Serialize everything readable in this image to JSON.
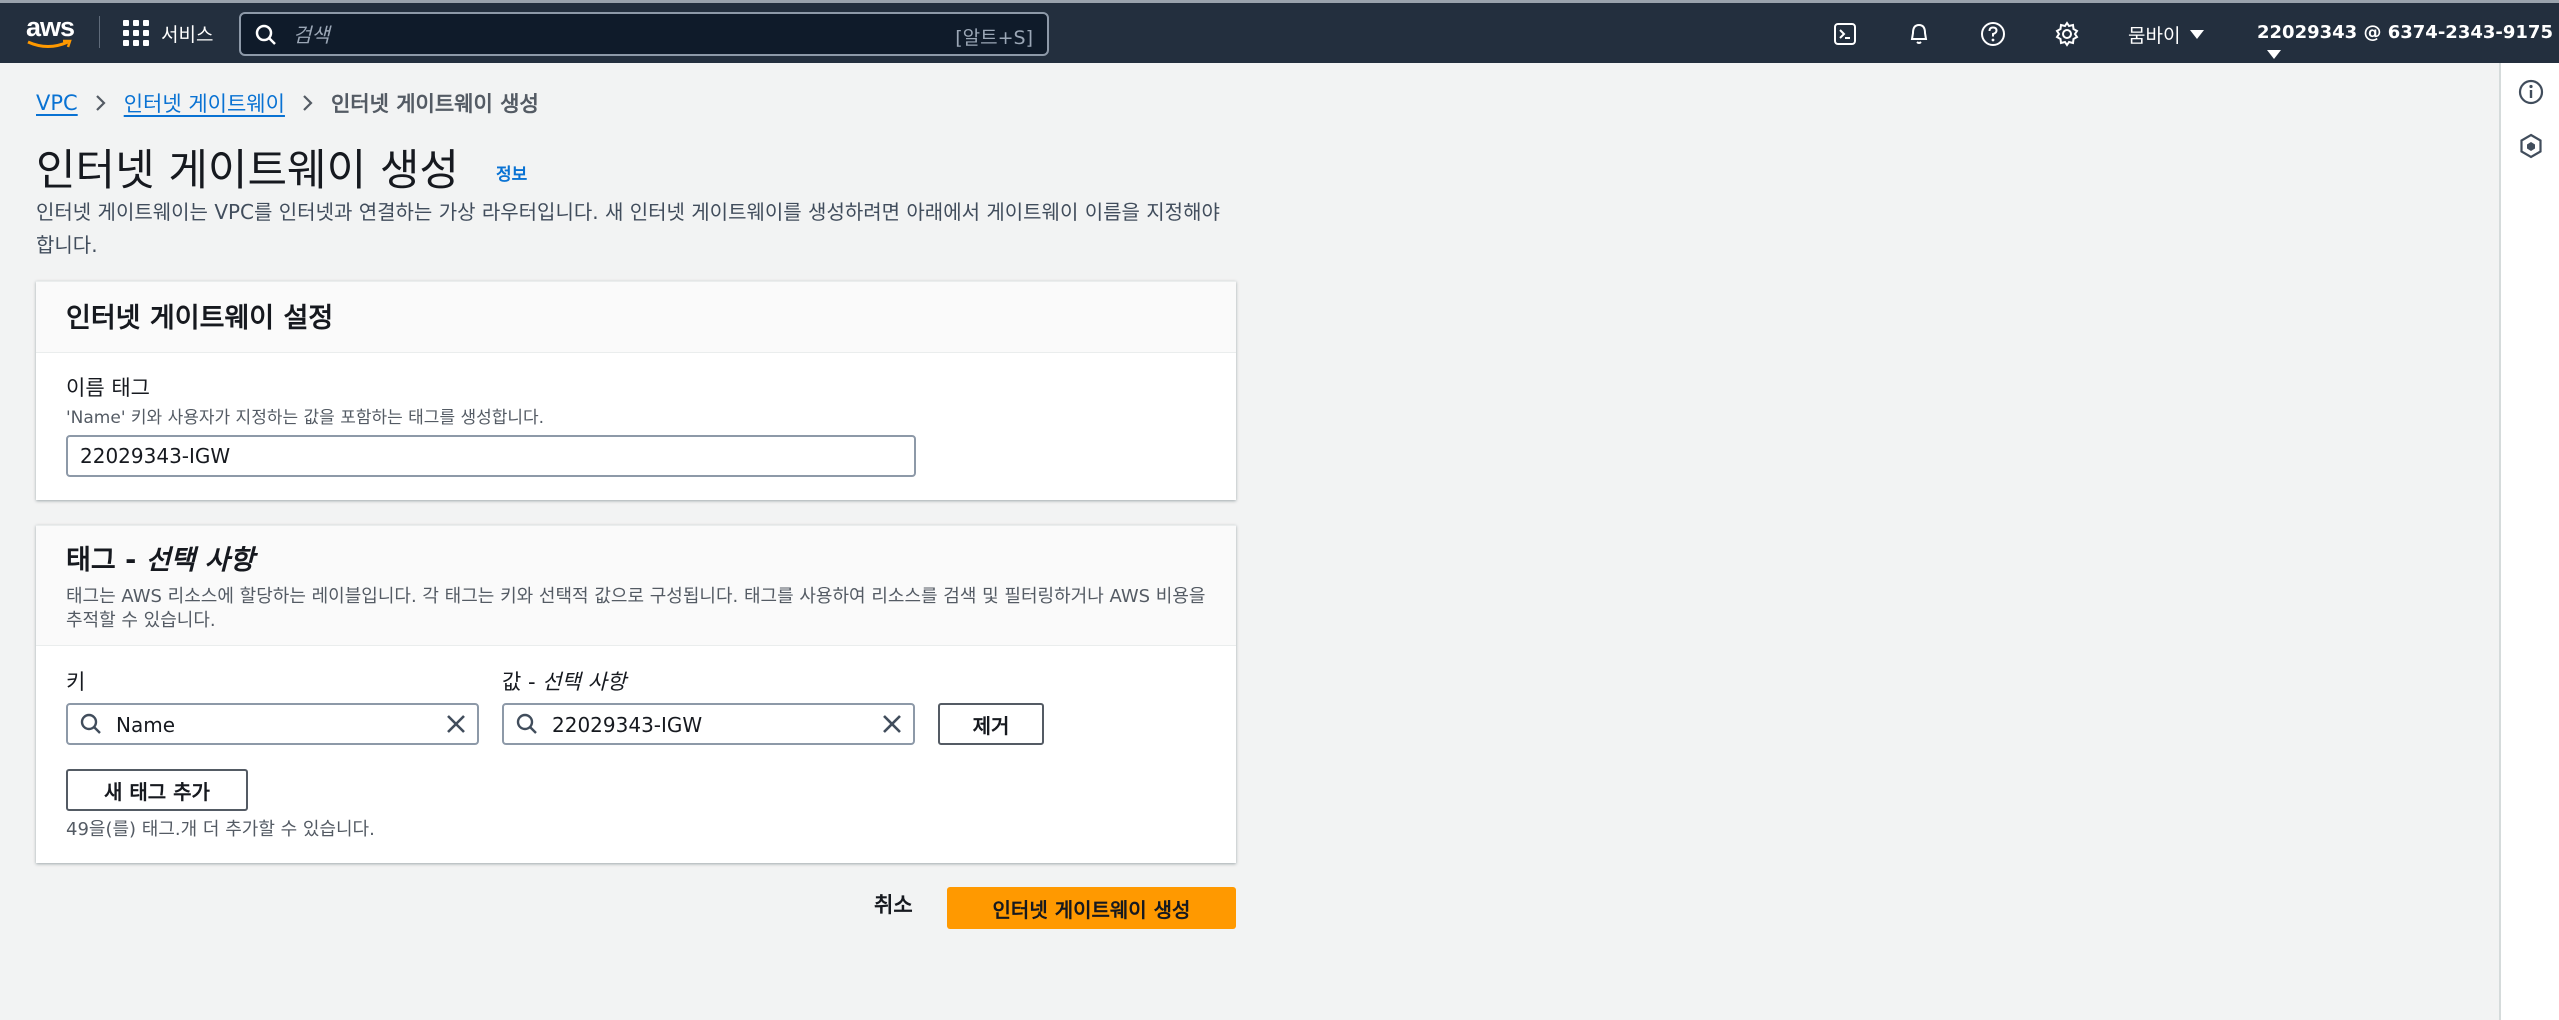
{
  "topnav": {
    "logo_text": "aws",
    "services_label": "서비스",
    "search_placeholder": "검색",
    "search_shortcut": "[알트+S]",
    "region": "뭄바이",
    "account": "22029343 @ 6374-2343-9175"
  },
  "breadcrumb": {
    "items": [
      "VPC",
      "인터넷 게이트웨이"
    ],
    "current": "인터넷 게이트웨이 생성"
  },
  "header": {
    "title": "인터넷 게이트웨이 생성",
    "info": "정보",
    "description": "인터넷 게이트웨이는 VPC를 인터넷과 연결하는 가상 라우터입니다. 새 인터넷 게이트웨이를 생성하려면 아래에서 게이트웨이 이름을 지정해야 합니다."
  },
  "settings": {
    "title": "인터넷 게이트웨이 설정",
    "name_label": "이름 태그",
    "name_desc": "'Name' 키와 사용자가 지정하는 값을 포함하는 태그를 생성합니다.",
    "name_value": "22029343-IGW"
  },
  "tags": {
    "title_main": "태그 - ",
    "title_opt": "선택 사항",
    "description": "태그는 AWS 리소스에 할당하는 레이블입니다. 각 태그는 키와 선택적 값으로 구성됩니다. 태그를 사용하여 리소스를 검색 및 필터링하거나 AWS 비용을 추적할 수 있습니다.",
    "key_label": "키",
    "value_label_main": "값 - ",
    "value_label_opt": "선택 사항",
    "key_value": "Name",
    "value_value": "22029343-IGW",
    "remove_label": "제거",
    "add_label": "새 태그 추가",
    "hint": "49을(를) 태그.개 더 추가할 수 있습니다."
  },
  "actions": {
    "cancel": "취소",
    "create": "인터넷 게이트웨이 생성"
  },
  "colors": {
    "nav_bg": "#232f3e",
    "link": "#0972d3",
    "primary": "#ff9900"
  }
}
